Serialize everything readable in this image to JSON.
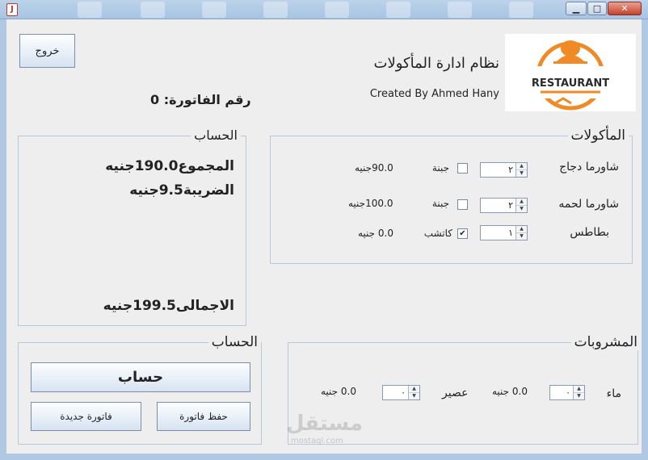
{
  "window": {
    "buttons": {
      "minimize": "▁",
      "maximize": "□",
      "close": "✕"
    }
  },
  "header": {
    "exit_label": "خروج",
    "app_title": "نظام ادارة المأكولات",
    "credit": "Created By Ahmed Hany",
    "invoice_label": "رقم الفاتورة: 0",
    "logo_text": "RESTAURANT"
  },
  "totals_panel": {
    "title": "الحساب",
    "subtotal": "المجموع190.0جنيه",
    "tax": "الضريبة9.5جنيه",
    "total": "الاجمالى199.5جنيه"
  },
  "food_panel": {
    "title": "المأكولات",
    "rows": [
      {
        "item": "شاورما دجاج",
        "qty": "٢",
        "option": "جبنة",
        "checked": false,
        "price": "90.0جنيه"
      },
      {
        "item": "شاورما لحمه",
        "qty": "٢",
        "option": "جبنة",
        "checked": false,
        "price": "100.0جنيه"
      },
      {
        "item": "بطاطس",
        "qty": "١",
        "option": "كاتشب",
        "checked": true,
        "price": "0.0 جنيه"
      }
    ]
  },
  "actions_panel": {
    "title": "الحساب",
    "calculate_label": "حساب",
    "save_label": "حفظ فاتورة",
    "new_label": "فاتورة جديدة"
  },
  "drinks_panel": {
    "title": "المشروبات",
    "water_label": "ماء",
    "water_qty": "٠",
    "water_price": "0.0 جنيه",
    "juice_label": "عصير",
    "juice_qty": "٠",
    "juice_price": "0.0 جنيه"
  },
  "watermark": {
    "text": "مستقل",
    "url": "mostaql.com"
  },
  "colors": {
    "accent": "#f08a24",
    "logo_dark": "#2b2b2b"
  }
}
